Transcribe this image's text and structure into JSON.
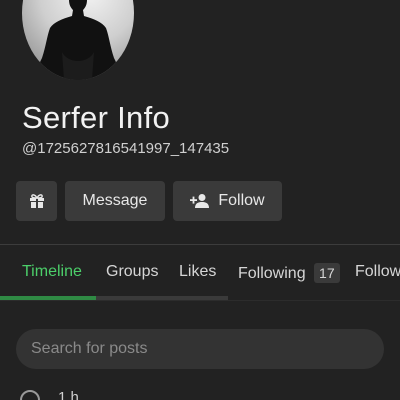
{
  "profile": {
    "display_name": "Serfer Info",
    "handle": "@1725627816541997_147435"
  },
  "actions": {
    "gift_icon": "gift-icon",
    "message_label": "Message",
    "follow_label": "Follow",
    "follow_icon": "person-add-icon"
  },
  "tabs": [
    {
      "label": "Timeline",
      "active": true
    },
    {
      "label": "Groups"
    },
    {
      "label": "Likes"
    },
    {
      "label": "Following",
      "count": "17"
    },
    {
      "label": "Follow"
    }
  ],
  "search": {
    "placeholder": "Search for posts"
  },
  "post": {
    "time": "1 h"
  },
  "colors": {
    "background": "#222222",
    "button": "#3a3a3a",
    "accent": "#4ccf6a"
  }
}
